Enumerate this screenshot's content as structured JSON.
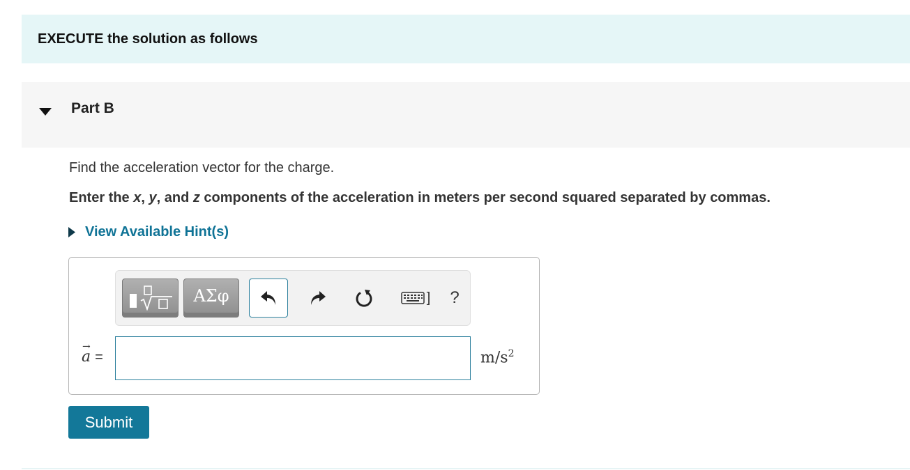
{
  "banner": {
    "text": "EXECUTE the solution as follows"
  },
  "part": {
    "title": "Part B",
    "expanded": true
  },
  "question": {
    "prompt": "Find the acceleration vector for the charge.",
    "instruction_pre": "Enter the ",
    "var_x": "x",
    "sep1": ", ",
    "var_y": "y",
    "sep2": ", and ",
    "var_z": "z",
    "instruction_post": " components of the acceleration in meters per second squared separated by commas."
  },
  "hints": {
    "label": "View Available Hint(s)"
  },
  "toolbar": {
    "templates_icon": "templates-icon",
    "symbols_label": "ΑΣφ",
    "undo_icon": "undo-icon",
    "redo_icon": "redo-icon",
    "reset_icon": "reset-icon",
    "keyboard_icon": "keyboard-icon",
    "keyboard_suffix": "]",
    "help_label": "?"
  },
  "answer": {
    "variable": "a",
    "equals": "=",
    "value": "",
    "units_base": "m/s",
    "units_exp": "2"
  },
  "submit": {
    "label": "Submit"
  },
  "colors": {
    "banner_bg": "#e5f6f7",
    "part_bg": "#f6f6f6",
    "link": "#0f7396",
    "submit_bg": "#137899",
    "input_border": "#2a7f9c"
  }
}
